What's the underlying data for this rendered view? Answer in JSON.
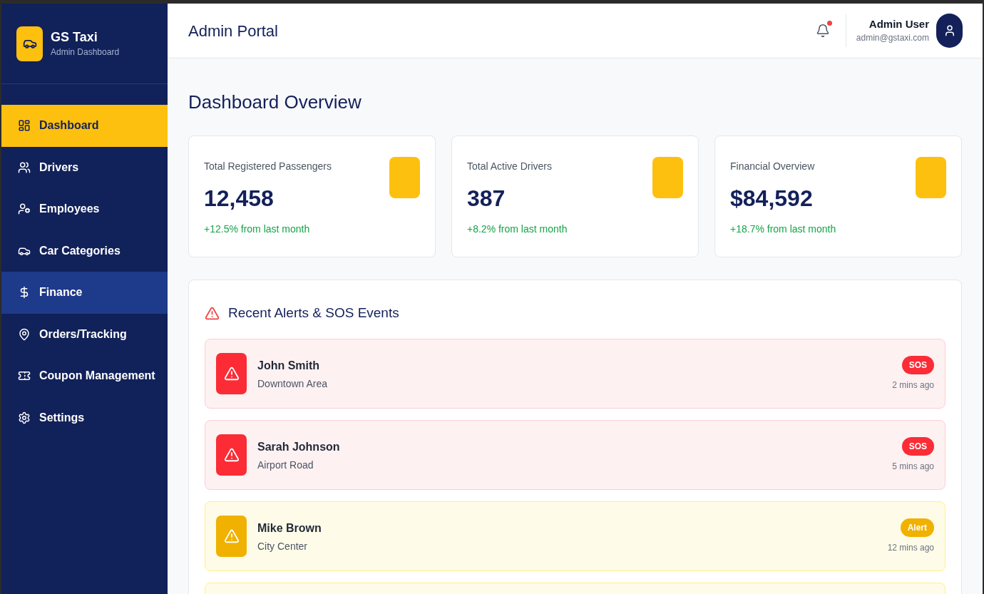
{
  "sidebar": {
    "brand": {
      "name": "GS Taxi",
      "subtitle": "Admin Dashboard"
    },
    "items": [
      {
        "label": "Dashboard",
        "selected": true,
        "highlighted": false
      },
      {
        "label": "Drivers",
        "selected": false,
        "highlighted": false
      },
      {
        "label": "Employees",
        "selected": false,
        "highlighted": false
      },
      {
        "label": "Car Categories",
        "selected": false,
        "highlighted": false
      },
      {
        "label": "Finance",
        "selected": false,
        "highlighted": true
      },
      {
        "label": "Orders/Tracking",
        "selected": false,
        "highlighted": false
      },
      {
        "label": "Coupon Management",
        "selected": false,
        "highlighted": false
      },
      {
        "label": "Settings",
        "selected": false,
        "highlighted": false
      }
    ]
  },
  "header": {
    "title": "Admin Portal",
    "notifications": {
      "unread": true
    },
    "user": {
      "name": "Admin User",
      "email": "admin@gstaxi.com"
    }
  },
  "page": {
    "title": "Dashboard Overview"
  },
  "stats": [
    {
      "label": "Total Registered Passengers",
      "value": "12,458",
      "change": "+12.5% from last month"
    },
    {
      "label": "Total Active Drivers",
      "value": "387",
      "change": "+8.2% from last month"
    },
    {
      "label": "Financial Overview",
      "value": "$84,592",
      "change": "+18.7% from last month"
    }
  ],
  "alerts": {
    "title": "Recent Alerts & SOS Events",
    "items": [
      {
        "kind": "sos",
        "name": "John Smith",
        "location": "Downtown Area",
        "badge": "SOS",
        "time": "2 mins ago"
      },
      {
        "kind": "sos",
        "name": "Sarah Johnson",
        "location": "Airport Road",
        "badge": "SOS",
        "time": "5 mins ago"
      },
      {
        "kind": "alert",
        "name": "Mike Brown",
        "location": "City Center",
        "badge": "Alert",
        "time": "12 mins ago"
      },
      {
        "kind": "alert"
      }
    ]
  }
}
